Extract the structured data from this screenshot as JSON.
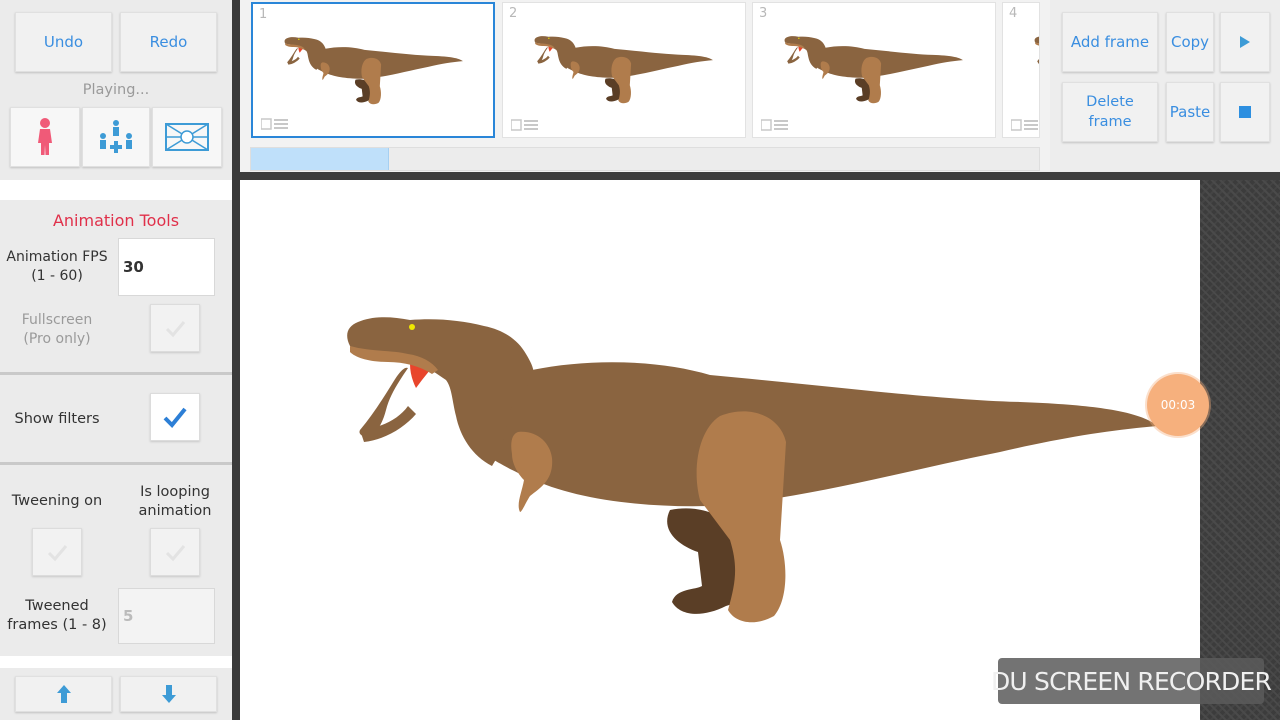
{
  "toolbar": {
    "undo_label": "Undo",
    "redo_label": "Redo",
    "status_text": "Playing...",
    "add_frame_label": "Add frame",
    "copy_label": "Copy",
    "delete_frame_label": "Delete frame",
    "paste_label": "Paste"
  },
  "animation_tools": {
    "title": "Animation Tools",
    "fps_label": "Animation FPS\n(1 - 60)",
    "fps_value": "30",
    "fullscreen_label": "Fullscreen\n(Pro only)",
    "fullscreen_checked": false,
    "show_filters_label": "Show filters",
    "show_filters_checked": true,
    "tweening_label": "Tweening on",
    "tweening_checked": false,
    "looping_label": "Is looping\nanimation",
    "looping_checked": false,
    "tweened_frames_label": "Tweened\nframes (1 - 8)",
    "tweened_frames_value": "5"
  },
  "frames": [
    {
      "number": "1",
      "selected": true
    },
    {
      "number": "2",
      "selected": false
    },
    {
      "number": "3",
      "selected": false
    },
    {
      "number": "4",
      "selected": false
    }
  ],
  "recorder": {
    "timer": "00:03",
    "watermark": "DU SCREEN RECORDER"
  },
  "colors": {
    "accent": "#3a8ee0",
    "title_red": "#e0304a",
    "dino_body": "#8a6440",
    "dino_limb_light": "#b07c4c",
    "dino_limb_dark": "#5a3e26",
    "dino_mouth": "#e8452c"
  },
  "icons": {
    "stick_figure": "stick-figure-icon",
    "group_figures": "group-figures-icon",
    "background": "background-icon",
    "play": "play-icon",
    "stop": "stop-icon",
    "move_up": "arrow-up-icon",
    "move_down": "arrow-down-icon"
  }
}
